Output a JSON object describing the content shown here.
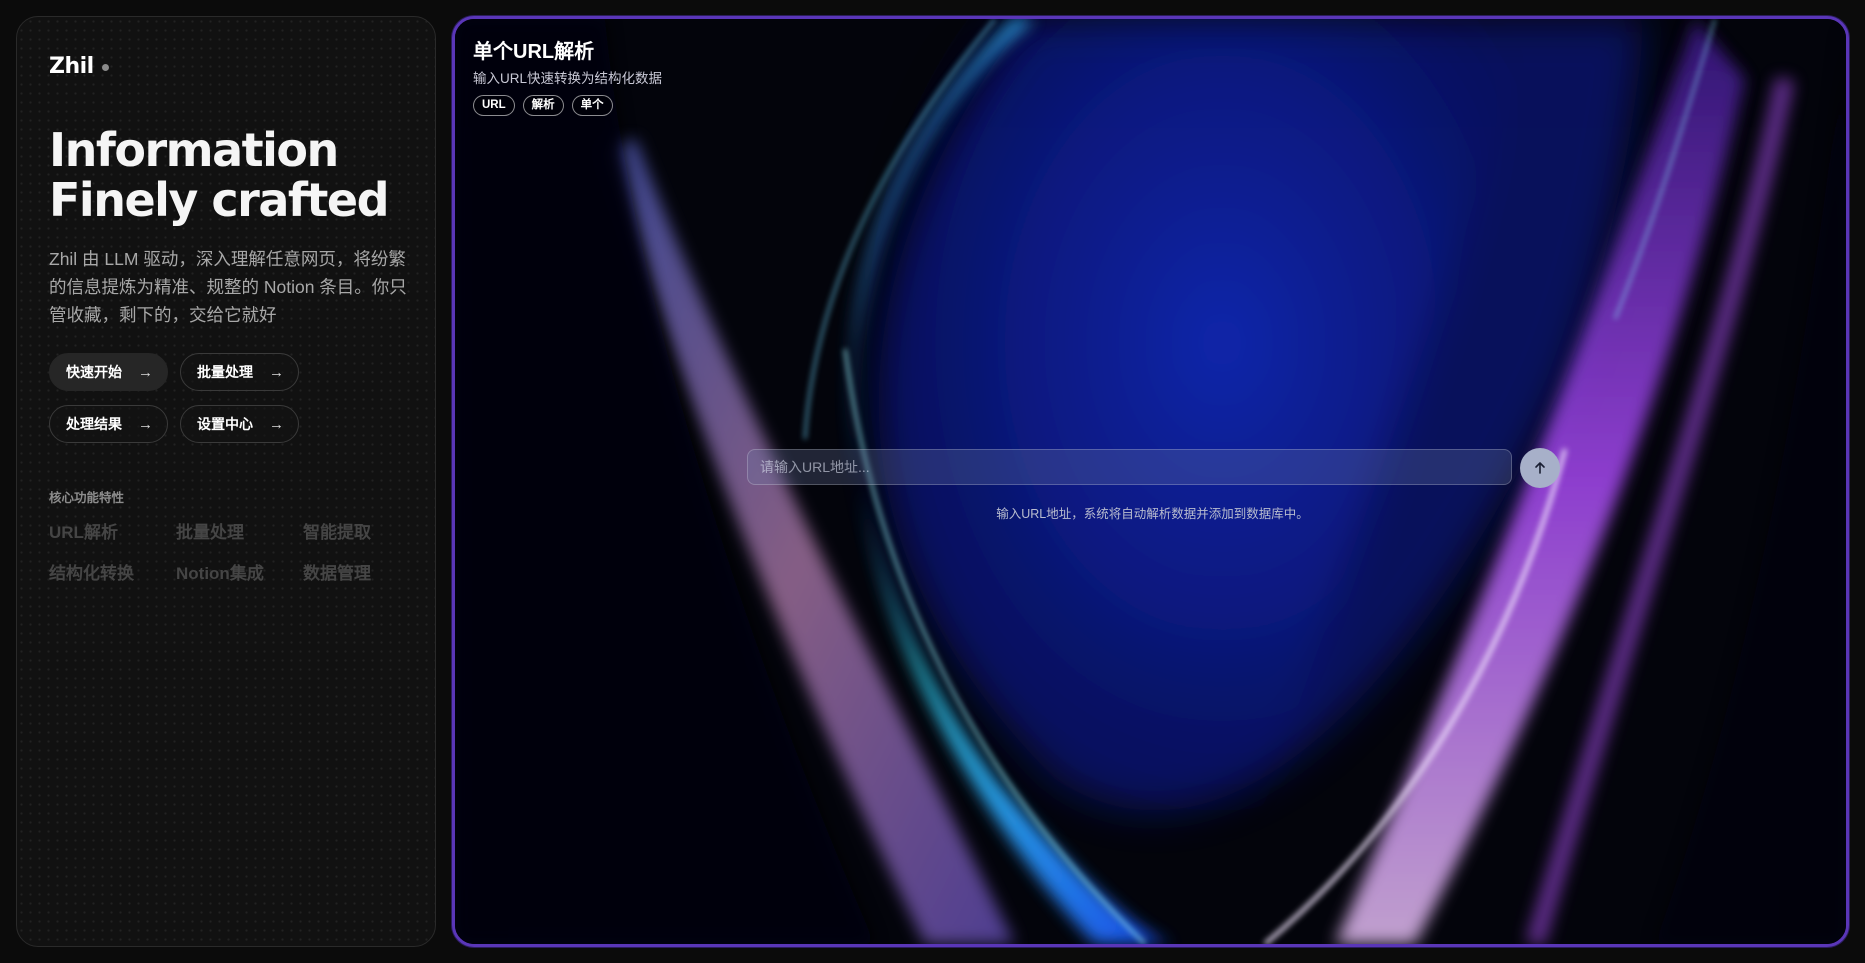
{
  "brand": {
    "name": "Zhil"
  },
  "hero": {
    "title_line1": "Information",
    "title_line2": "Finely crafted",
    "description": "Zhil 由 LLM 驱动，深入理解任意网页，将纷繁的信息提炼为精准、规整的 Notion 条目。你只管收藏，剩下的，交给它就好"
  },
  "actions": [
    {
      "label": "快速开始",
      "icon": "arrow-right-icon"
    },
    {
      "label": "批量处理",
      "icon": "arrow-right-icon"
    },
    {
      "label": "处理结果",
      "icon": "arrow-right-icon"
    },
    {
      "label": "设置中心",
      "icon": "arrow-right-icon"
    }
  ],
  "features": {
    "heading": "核心功能特性",
    "items": [
      "URL解析",
      "批量处理",
      "智能提取",
      "结构化转换",
      "Notion集成",
      "数据管理"
    ]
  },
  "main": {
    "title": "单个URL解析",
    "subtitle": "输入URL快速转换为结构化数据",
    "tags": [
      "URL",
      "解析",
      "单个"
    ],
    "input_placeholder": "请输入URL地址...",
    "input_value": "",
    "submit_icon": "arrow-up-icon",
    "hint": "输入URL地址，系统将自动解析数据并添加到数据库中。"
  },
  "colors": {
    "accent_border": "#5a36b8",
    "background": "#0b0b0b",
    "panel": "#111111"
  }
}
